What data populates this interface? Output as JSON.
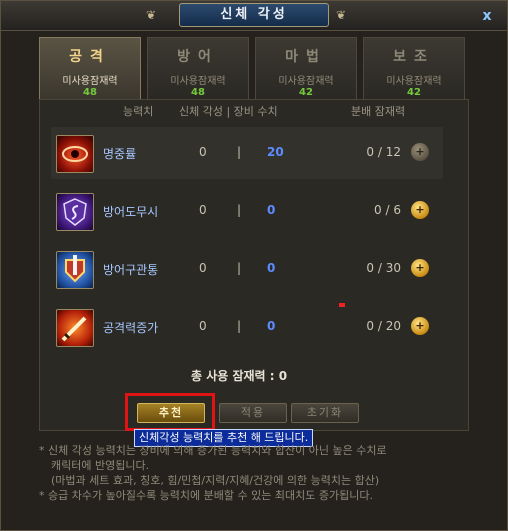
{
  "window": {
    "title": "신체 각성",
    "close_label": "x"
  },
  "tabs": [
    {
      "label": "공격",
      "sub": "미사용잠재력",
      "value": "48",
      "active": true
    },
    {
      "label": "방어",
      "sub": "미사용잠재력",
      "value": "48",
      "active": false
    },
    {
      "label": "마법",
      "sub": "미사용잠재력",
      "value": "42",
      "active": false
    },
    {
      "label": "보조",
      "sub": "미사용잠재력",
      "value": "42",
      "active": false
    }
  ],
  "columns": {
    "stat": "능력치",
    "body_gear": "신체 각성 | 장비 수치",
    "dist": "분배 잠재력"
  },
  "rows": [
    {
      "name": "명중률",
      "body": "0",
      "sep": "|",
      "gear": "20",
      "dist": "0 / 12",
      "plus": "+",
      "icon": "eye-icon"
    },
    {
      "name": "방어도무시",
      "body": "0",
      "sep": "|",
      "gear": "0",
      "dist": "0 / 6",
      "plus": "+",
      "icon": "shield-serpent-icon"
    },
    {
      "name": "방어구관통",
      "body": "0",
      "sep": "|",
      "gear": "0",
      "dist": "0 / 30",
      "plus": "+",
      "icon": "pierce-shield-icon"
    },
    {
      "name": "공격력증가",
      "body": "0",
      "sep": "|",
      "gear": "0",
      "dist": "0 / 20",
      "plus": "+",
      "icon": "fire-sword-icon"
    }
  ],
  "total_label": "총 사용 잠재력 : 0",
  "buttons": {
    "recommend": "추천",
    "apply": "적용",
    "reset": "초기화"
  },
  "tooltip": "신체각성 능력치를 추천 해 드립니다.",
  "notes": [
    "* 신체 각성 능력치는 장비에 의해 증가된 능력치와 합산이 아닌 높은 수치로",
    "캐릭터에 반영됩니다.",
    "(마법과 세트 효과, 칭호, 힘/민첩/지력/지혜/건강에 의한 능력치는 합산)",
    "* 승급 차수가 높아질수록 능력치에 분배할 수 있는 최대치도 증가됩니다."
  ],
  "colors": {
    "accent_gold": "#f2d48a",
    "value_green": "#75c93c",
    "gear_blue": "#5c8cff",
    "tooltip_bg": "#0b2c9a",
    "highlight_red": "#e01414"
  }
}
